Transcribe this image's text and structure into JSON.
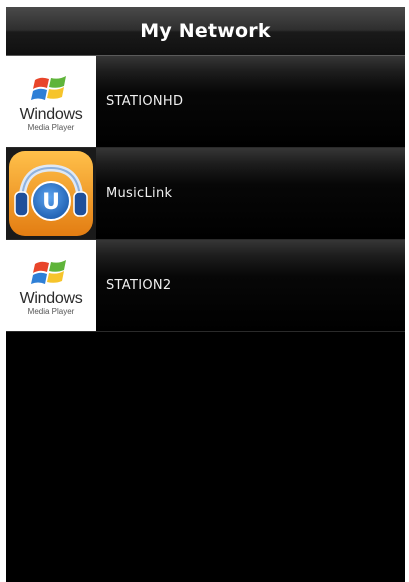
{
  "header": {
    "title": "My Network"
  },
  "servers": [
    {
      "name": "STATIONHD",
      "icon": "windows-media-player-icon",
      "logo_text": "Windows",
      "logo_subtext": "Media Player"
    },
    {
      "name": "MusicLink",
      "icon": "musiclink-headphones-icon",
      "logo_letter": "U"
    },
    {
      "name": "STATION2",
      "icon": "windows-media-player-icon",
      "logo_text": "Windows",
      "logo_subtext": "Media Player"
    }
  ],
  "colors": {
    "background": "#000000",
    "titlebar": "#2e2e2e",
    "text": "#ffffff",
    "musiclink_orange": "#f39a1e",
    "musiclink_blue": "#1f5fb0"
  }
}
